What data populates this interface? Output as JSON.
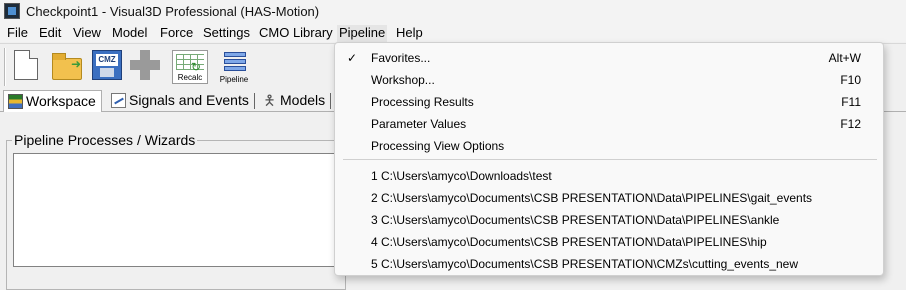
{
  "window": {
    "title": "Checkpoint1 - Visual3D Professional (HAS-Motion)"
  },
  "menubar": {
    "file": "File",
    "edit": "Edit",
    "view": "View",
    "model": "Model",
    "force": "Force",
    "settings": "Settings",
    "cmo_library": "CMO Library",
    "pipeline": "Pipeline",
    "help": "Help"
  },
  "toolbar": {
    "save_label": "CMZ",
    "recalc_label": "Recalc",
    "pipeline_label": "Pipeline"
  },
  "tabs": {
    "workspace": "Workspace",
    "signals": "Signals and Events",
    "models": "Models"
  },
  "panel": {
    "group_title": "Pipeline Processes / Wizards"
  },
  "pipeline_menu": {
    "items": [
      {
        "label": "Favorites...",
        "shortcut": "Alt+W",
        "checked": true,
        "check_glyph": "✓"
      },
      {
        "label": "Workshop...",
        "shortcut": "F10"
      },
      {
        "label": "Processing Results",
        "shortcut": "F11"
      },
      {
        "label": "Parameter Values",
        "shortcut": "F12"
      },
      {
        "label": "Processing View Options",
        "shortcut": ""
      }
    ],
    "recent": [
      "1 C:\\Users\\amyco\\Downloads\\test",
      "2 C:\\Users\\amyco\\Documents\\CSB PRESENTATION\\Data\\PIPELINES\\gait_events",
      "3 C:\\Users\\amyco\\Documents\\CSB PRESENTATION\\Data\\PIPELINES\\ankle",
      "4 C:\\Users\\amyco\\Documents\\CSB PRESENTATION\\Data\\PIPELINES\\hip",
      "5 C:\\Users\\amyco\\Documents\\CSB PRESENTATION\\CMZs\\cutting_events_new"
    ]
  }
}
